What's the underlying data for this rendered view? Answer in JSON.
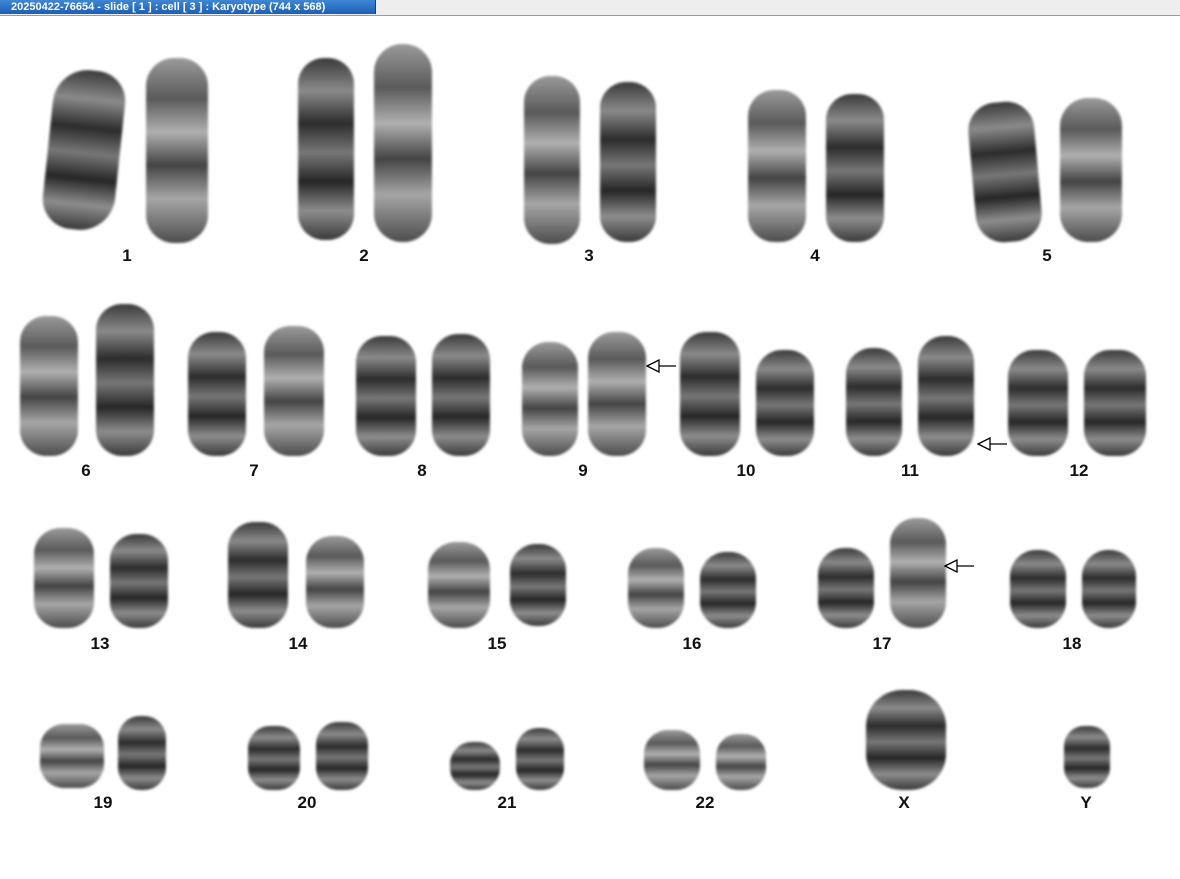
{
  "window": {
    "title": "20250422-76654 - slide [ 1 ] : cell [ 3 ] : Karyotype  (744 x 568)"
  },
  "labels": {
    "c1": "1",
    "c2": "2",
    "c3": "3",
    "c4": "4",
    "c5": "5",
    "c6": "6",
    "c7": "7",
    "c8": "8",
    "c9": "9",
    "c10": "10",
    "c11": "11",
    "c12": "12",
    "c13": "13",
    "c14": "14",
    "c15": "15",
    "c16": "16",
    "c17": "17",
    "c18": "18",
    "c19": "19",
    "c20": "20",
    "c21": "21",
    "c22": "22",
    "cX": "X",
    "cY": "Y"
  },
  "colors": {
    "title_tab": "#1c5fb4",
    "chromosome": "#2c2c2c",
    "arrow": "#000000"
  }
}
